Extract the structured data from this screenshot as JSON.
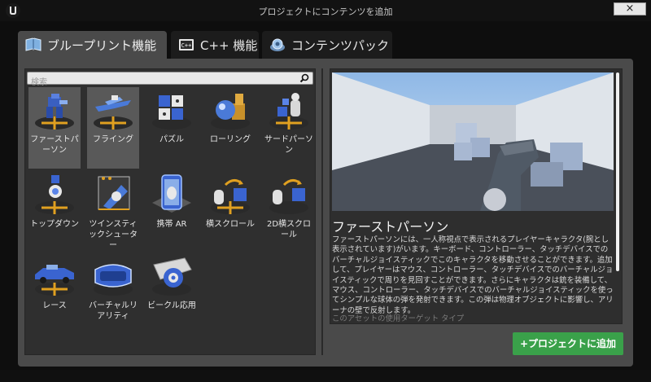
{
  "window": {
    "title": "プロジェクトにコンテンツを追加",
    "close_label": "×"
  },
  "tabs": [
    {
      "label": "ブループリント機能",
      "icon": "book-icon",
      "active": true
    },
    {
      "label": "C++ 機能",
      "icon": "cpp-icon",
      "active": false
    },
    {
      "label": "コンテンツパック",
      "icon": "content-pack-icon",
      "active": false
    }
  ],
  "search": {
    "placeholder": "検索",
    "value": ""
  },
  "templates": [
    {
      "label": "ファーストパーソン",
      "icon": "first-person-icon",
      "selected": true
    },
    {
      "label": "フライング",
      "icon": "flying-icon",
      "selected": true
    },
    {
      "label": "パズル",
      "icon": "puzzle-icon",
      "selected": false
    },
    {
      "label": "ローリング",
      "icon": "rolling-icon",
      "selected": false
    },
    {
      "label": "サードパーソン",
      "icon": "third-person-icon",
      "selected": false
    },
    {
      "label": "トップダウン",
      "icon": "top-down-icon",
      "selected": false
    },
    {
      "label": "ツインスティックシューター",
      "icon": "twin-stick-icon",
      "selected": false
    },
    {
      "label": "携帯 AR",
      "icon": "handheld-ar-icon",
      "selected": false
    },
    {
      "label": "横スクロール",
      "icon": "side-scroller-icon",
      "selected": false
    },
    {
      "label": "2D横スクロール",
      "icon": "side-scroller-2d-icon",
      "selected": false
    },
    {
      "label": "レース",
      "icon": "vehicle-icon",
      "selected": false
    },
    {
      "label": "バーチャルリアリティ",
      "icon": "vr-icon",
      "selected": false
    },
    {
      "label": "ビークル応用",
      "icon": "vehicle-advanced-icon",
      "selected": false
    }
  ],
  "detail": {
    "title": "ファーストパーソン",
    "description": "ファーストパーソンには、一人称視点で表示されるプレイヤーキャラクタ(腕とし表示されています)がいます。キーボード、コントローラー、タッチデバイスでのバーチャルジョイスティックでこのキャラクタを移動させることができます。追加して、プレイヤーはマウス、コントローラー、タッチデバイスでのバーチャルジョイスティックで周りを見回すことができます。さらにキャラクタは銃を装備して、マウス、コントローラー、タッチデバイスでのバーチャルジョイスティックを使ってシンプルな球体の弾を発射できます。この弾は物理オブジェクトに影響し、アリーナの壁で反射します。",
    "more": "このアセットの使用ターゲット タイプ",
    "preview": "first-person-preview-image"
  },
  "actions": {
    "add_label": "+プロジェクトに追加"
  },
  "colors": {
    "accent_green": "#3aa14a",
    "panel": "#4a4a4a",
    "pane": "#2f2f2f",
    "selected": "#595959"
  }
}
